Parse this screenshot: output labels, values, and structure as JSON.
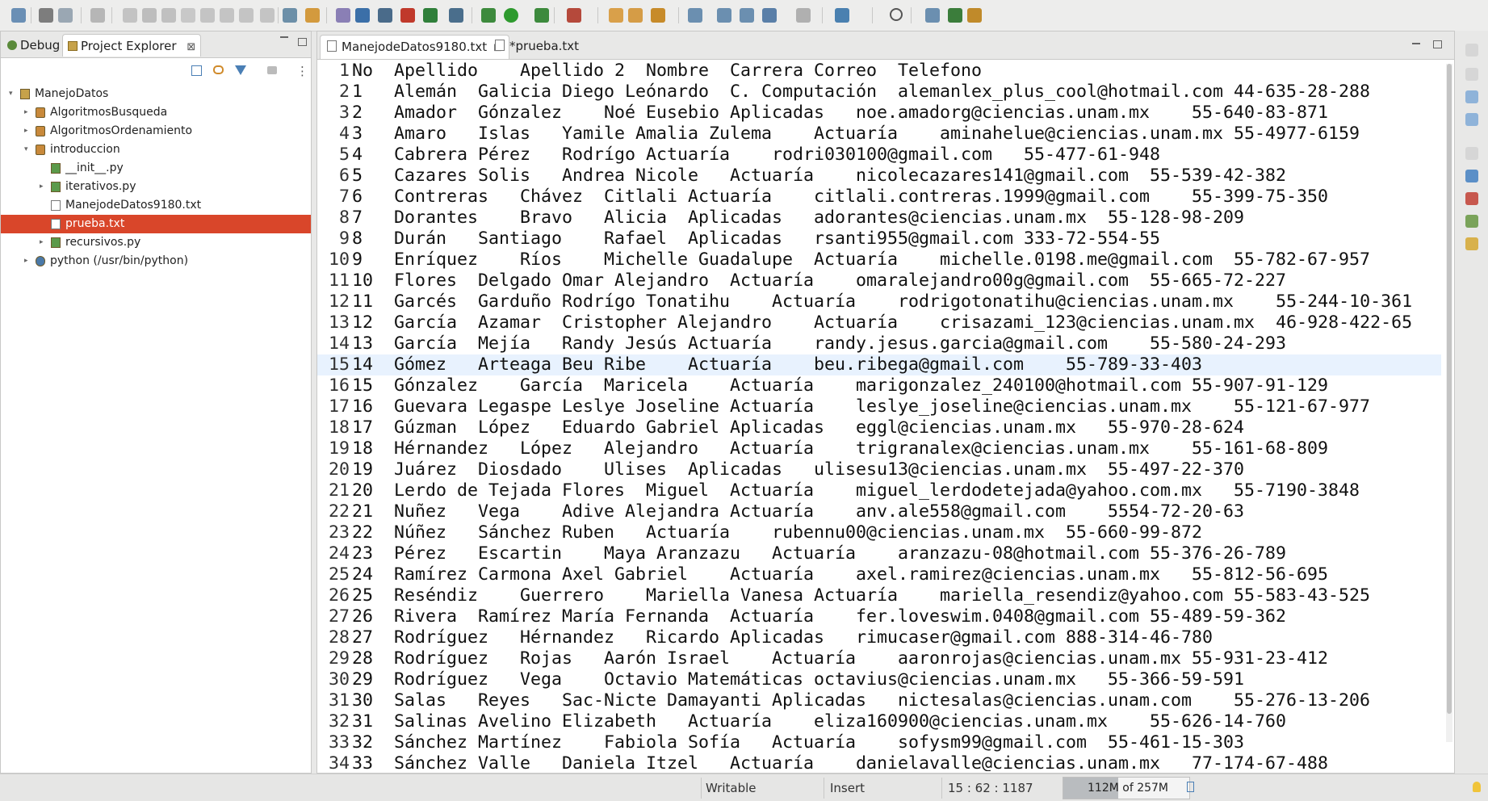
{
  "toolbar": {
    "icons": [
      "new-icon",
      "save-icon",
      "save-all-icon",
      "skip-breakpoints-icon",
      "resume-icon",
      "suspend-icon",
      "terminate-icon",
      "disconnect-icon",
      "step-into-icon",
      "step-over-icon",
      "step-return-icon",
      "drop-to-frame-icon",
      "use-step-filters-icon",
      "toggle-breadcrumb-icon",
      "toggle-mark-occurrences-icon",
      "show-whitespace-icon",
      "pydev-icon",
      "remove-markers-icon",
      "coverage-icon",
      "open-type-icon",
      "debug-icon",
      "run-icon",
      "run-coverage-icon",
      "external-tools-icon",
      "open-folder-icon",
      "open-file-icon",
      "tools-icon",
      "next-annotation-icon",
      "previous-annotation-icon",
      "last-edit-icon",
      "back-icon",
      "forward-icon",
      "open-perspective-icon",
      "search-icon",
      "java-perspective-icon",
      "debug-perspective-icon",
      "pydev-perspective-icon"
    ]
  },
  "left_panel": {
    "tabs": [
      {
        "label": "Debug",
        "active": false
      },
      {
        "label": "Project Explorer",
        "active": true
      }
    ],
    "close_glyph": "⊠",
    "tree": [
      {
        "label": "ManejoDatos",
        "depth": 0,
        "twisty": "▾",
        "icon": "project"
      },
      {
        "label": "AlgoritmosBusqueda",
        "depth": 1,
        "twisty": "▸",
        "icon": "package"
      },
      {
        "label": "AlgoritmosOrdenamiento",
        "depth": 1,
        "twisty": "▸",
        "icon": "package"
      },
      {
        "label": "introduccion",
        "depth": 1,
        "twisty": "▾",
        "icon": "package"
      },
      {
        "label": "__init__.py",
        "depth": 2,
        "twisty": "",
        "icon": "py"
      },
      {
        "label": "iterativos.py",
        "depth": 2,
        "twisty": "▸",
        "icon": "py"
      },
      {
        "label": "ManejodeDatos9180.txt",
        "depth": 2,
        "twisty": "",
        "icon": "txt"
      },
      {
        "label": "prueba.txt",
        "depth": 2,
        "twisty": "",
        "icon": "txt",
        "selected": true
      },
      {
        "label": "recursivos.py",
        "depth": 2,
        "twisty": "▸",
        "icon": "py"
      },
      {
        "label": "python (/usr/bin/python)",
        "depth": 1,
        "twisty": "▸",
        "icon": "python"
      }
    ]
  },
  "editor": {
    "tabs": [
      {
        "label": "ManejodeDatos9180.txt",
        "active": true,
        "close": "⊠"
      },
      {
        "label": "*prueba.txt",
        "active": false,
        "close": ""
      }
    ],
    "current_line": 15,
    "lines": [
      "No\tApellido\tApellido 2\tNombre\tCarrera\tCorreo\tTelefono",
      "1\tAlemán\tGalicia\tDiego Leónardo\tC. Computación\talemanlex_plus_cool@hotmail.com\t44-635-28-288",
      "2\tAmador\tGónzalez\tNoé Eusebio\tAplicadas\tnoe.amadorg@ciencias.unam.mx\t55-640-83-871",
      "3\tAmaro\tIslas\tYamile Amalia Zulema\tActuaría\taminahelue@ciencias.unam.mx\t55-4977-6159",
      "4\tCabrera\tPérez\tRodrígo\tActuaría\trodri030100@gmail.com\t55-477-61-948",
      "5\tCazares\tSolis\tAndrea Nicole\tActuaría\tnicolecazares141@gmail.com\t55-539-42-382",
      "6\tContreras\tChávez\tCitlali\tActuaría\tcitlali.contreras.1999@gmail.com\t55-399-75-350",
      "7\tDorantes\tBravo\tAlicia\tAplicadas\tadorantes@ciencias.unam.mx\t55-128-98-209",
      "8\tDurán\tSantiago\tRafael\tAplicadas\trsanti955@gmail.com\t333-72-554-55",
      "9\tEnríquez\tRíos\tMichelle Guadalupe\tActuaría\tmichelle.0198.me@gmail.com\t55-782-67-957",
      "10\tFlores\tDelgado\tOmar Alejandro\tActuaría\tomaralejandro00g@gmail.com\t55-665-72-227",
      "11\tGarcés\tGarduño\tRodrígo Tonatihu\tActuaría\trodrigotonatihu@ciencias.unam.mx\t55-244-10-361",
      "12\tGarcía\tAzamar\tCristopher Alejandro\tActuaría\tcrisazami_123@ciencias.unam.mx\t46-928-422-65",
      "13\tGarcía\tMejía\tRandy Jesús\tActuaría\trandy.jesus.garcia@gmail.com\t55-580-24-293",
      "14\tGómez\tArteaga\tBeu Ribe\tActuaría\tbeu.ribega@gmail.com\t55-789-33-403",
      "15\tGónzalez\tGarcía\tMaricela\tActuaría\tmarigonzalez_240100@hotmail.com\t55-907-91-129",
      "16\tGuevara\tLegaspe\tLeslye Joseline\tActuaría\tleslye_joseline@ciencias.unam.mx\t55-121-67-977",
      "17\tGúzman\tLópez\tEduardo Gabriel\tAplicadas\teggl@ciencias.unam.mx\t55-970-28-624",
      "18\tHérnandez\tLópez\tAlejandro\tActuaría\ttrigranalex@ciencias.unam.mx\t55-161-68-809",
      "19\tJuárez\tDiosdado\tUlises\tAplicadas\tulisesu13@ciencias.unam.mx\t55-497-22-370",
      "20\tLerdo de Tejada\tFlores\tMiguel\tActuaría\tmiguel_lerdodetejada@yahoo.com.mx\t55-7190-3848",
      "21\tNuñez\tVega\tAdive Alejandra\tActuaría\tanv.ale558@gmail.com\t5554-72-20-63",
      "22\tNúñez\tSánchez\tRuben\tActuaría\trubennu00@ciencias.unam.mx\t55-660-99-872",
      "23\tPérez\tEscartin\tMaya Aranzazu\tActuaría\taranzazu-08@hotmail.com\t55-376-26-789",
      "24\tRamírez\tCarmona\tAxel Gabriel\tActuaría\taxel.ramirez@ciencias.unam.mx\t55-812-56-695",
      "25\tReséndiz\tGuerrero\tMariella Vanesa\tActuaría\tmariella_resendiz@yahoo.com\t55-583-43-525",
      "26\tRivera\tRamírez\tMaría Fernanda\tActuaría\tfer.loveswim.0408@gmail.com\t55-489-59-362",
      "27\tRodríguez\tHérnandez\tRicardo\tAplicadas\trimucaser@gmail.com\t888-314-46-780",
      "28\tRodríguez\tRojas\tAarón Israel\tActuaría\taaronrojas@ciencias.unam.mx\t55-931-23-412",
      "29\tRodríguez\tVega\tOctavio\tMatemáticas\toctavius@ciencias.unam.mx\t55-366-59-591",
      "30\tSalas\tReyes\tSac-Nicte Damayanti\tAplicadas\tnictesalas@ciencias.unam.com\t55-276-13-206",
      "31\tSalinas\tAvelino\tElizabeth\tActuaría\teliza160900@ciencias.unam.mx\t55-626-14-760",
      "32\tSánchez\tMartínez\tFabiola Sofía\tActuaría\tsofysm99@gmail.com\t55-461-15-303",
      "33\tSánchez\tValle\tDaniela Itzel\tActuaría\tdanielavalle@ciencias.unam.mx\t77-174-67-488"
    ]
  },
  "status": {
    "writable": "Writable",
    "insert": "Insert",
    "position": "15 : 62 : 1187",
    "heap_used": "112M",
    "heap_total": "of 257M",
    "heap_fraction": 0.436
  },
  "colors": {
    "selection": "#d9462a",
    "current_line": "#e8f2fe",
    "run_green": "#3b9c3b",
    "debug_green": "#2f8f2f"
  }
}
